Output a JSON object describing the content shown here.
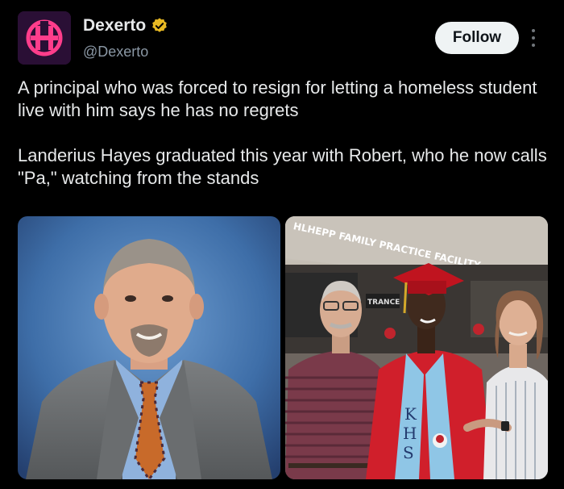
{
  "author": {
    "display_name": "Dexerto",
    "handle": "@Dexerto",
    "verified_badge_color": "#e8b923",
    "avatar_colors": {
      "background": "#2a0f35",
      "logo": "#ff3d8b"
    }
  },
  "actions": {
    "follow_label": "Follow",
    "more_icon": "more-vertical-icon"
  },
  "tweet": {
    "paragraphs": [
      "A principal who was forced to resign for letting a homeless student live with him says he has no regrets",
      "Landerius Hayes graduated this year with Robert, who he now calls \"Pa,\" watching from the stands"
    ]
  },
  "media": {
    "left_photo": {
      "subject": "portrait of man in grey suit and patterned tie against blue backdrop"
    },
    "right_photo": {
      "subject": "three people at graduation in front of building",
      "building_sign": "HLHEPP FAMILY PRACTICE FACILITY",
      "entrance_sign": "TRANCE",
      "stole_letters": [
        "K",
        "H",
        "S"
      ]
    }
  }
}
